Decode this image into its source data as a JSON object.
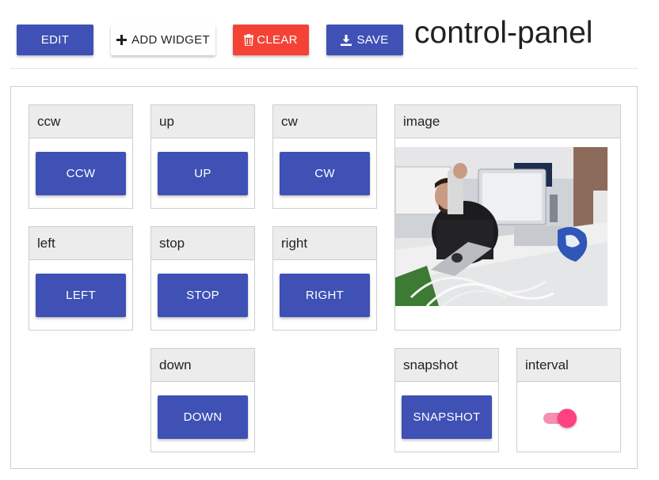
{
  "toolbar": {
    "edit_label": "EDIT",
    "add_widget_label": "ADD WIDGET",
    "clear_label": "CLEAR",
    "save_label": "SAVE",
    "add_icon": "plus-icon",
    "clear_icon": "trash-icon",
    "save_icon": "download-icon"
  },
  "page": {
    "title": "control-panel"
  },
  "widgets": {
    "ccw": {
      "title": "ccw",
      "button": "CCW"
    },
    "up": {
      "title": "up",
      "button": "UP"
    },
    "cw": {
      "title": "cw",
      "button": "CW"
    },
    "image": {
      "title": "image"
    },
    "left": {
      "title": "left",
      "button": "LEFT"
    },
    "stop": {
      "title": "stop",
      "button": "STOP"
    },
    "right": {
      "title": "right",
      "button": "RIGHT"
    },
    "down": {
      "title": "down",
      "button": "DOWN"
    },
    "snapshot": {
      "title": "snapshot",
      "button": "SNAPSHOT"
    },
    "interval": {
      "title": "interval",
      "toggle_on": true
    }
  },
  "colors": {
    "primary": "#3f51b5",
    "danger": "#f44336",
    "toggle_accent": "#ff4081",
    "header_bg": "#ececec"
  }
}
